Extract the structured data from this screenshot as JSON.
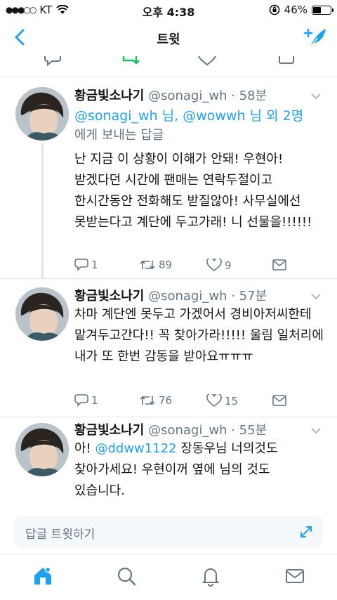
{
  "status_bar": {
    "carrier": "KT",
    "time": "오후 4:38",
    "battery": "46%",
    "battery_level": 0.46
  },
  "nav": {
    "title": "트윗",
    "back_icon": "back-arrow-icon",
    "compose_icon": "compose-tweet-icon"
  },
  "tweets": [
    {
      "name": "황금빛소나기",
      "handle": "@sonagi_wh",
      "time": "· 58분",
      "reply_to_a": "@sonagi_wh",
      "reply_to_mid": " 님, ",
      "reply_to_b": "@wowwh",
      "reply_to_tail": " 님 외 2명",
      "reply_to_suffix": "에게 보내는 답글",
      "text": "난 지금 이 상황이 이해가 안돼! 우현아! 받겠다던 시간에 팬매는 연락두절이고 한시간동안 전화해도 받질않아!  사무실에선 못받는다고 계단에 두고가래! 니 선물을!!!!!!",
      "replies": "1",
      "retweets": "89",
      "likes": "9"
    },
    {
      "name": "황금빛소나기",
      "handle": "@sonagi_wh",
      "time": "· 57분",
      "text": "차마 계단엔 못두고 가겠어서 경비아저씨한테 맡겨두고간다!! 꼭 찾아가라!!!!! 울림 일처리에 내가 또 한번 감동을 받아요ㅠㅠㅠ",
      "replies": "1",
      "retweets": "76",
      "likes": "15"
    },
    {
      "name": "황금빛소나기",
      "handle": "@sonagi_wh",
      "time": "· 55분",
      "text_pre": "아! ",
      "mention": "@ddww1122",
      "text_post": " 장동우님 너의것도 찾아가세요!  우현이꺼 옆에 님의 것도 있습니다."
    }
  ],
  "reply_box": {
    "placeholder": "답글 트윗하기"
  },
  "tabs": [
    "home-icon",
    "search-icon",
    "notifications-icon",
    "messages-icon"
  ],
  "colors": {
    "accent": "#1da1f2",
    "muted": "#657786",
    "retweet_green": "#17bf63"
  }
}
